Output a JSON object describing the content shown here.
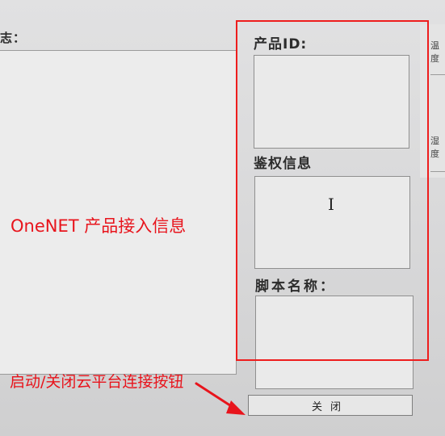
{
  "log_panel": {
    "title": "志："
  },
  "fields": {
    "product_id": {
      "label": "产品ID:",
      "value": ""
    },
    "auth_info": {
      "label": "鉴权信息",
      "value": ""
    },
    "script_name": {
      "label": "脚本名称：",
      "value": ""
    }
  },
  "close_button": {
    "label": "关闭"
  },
  "edge_window": {
    "label_1": "温度",
    "label_2": "湿度"
  },
  "annotations": {
    "product_access": "OneNET 产品接入信息",
    "connect_toggle": "启动/关闭云平台连接按钮",
    "color": "#e8141c"
  }
}
